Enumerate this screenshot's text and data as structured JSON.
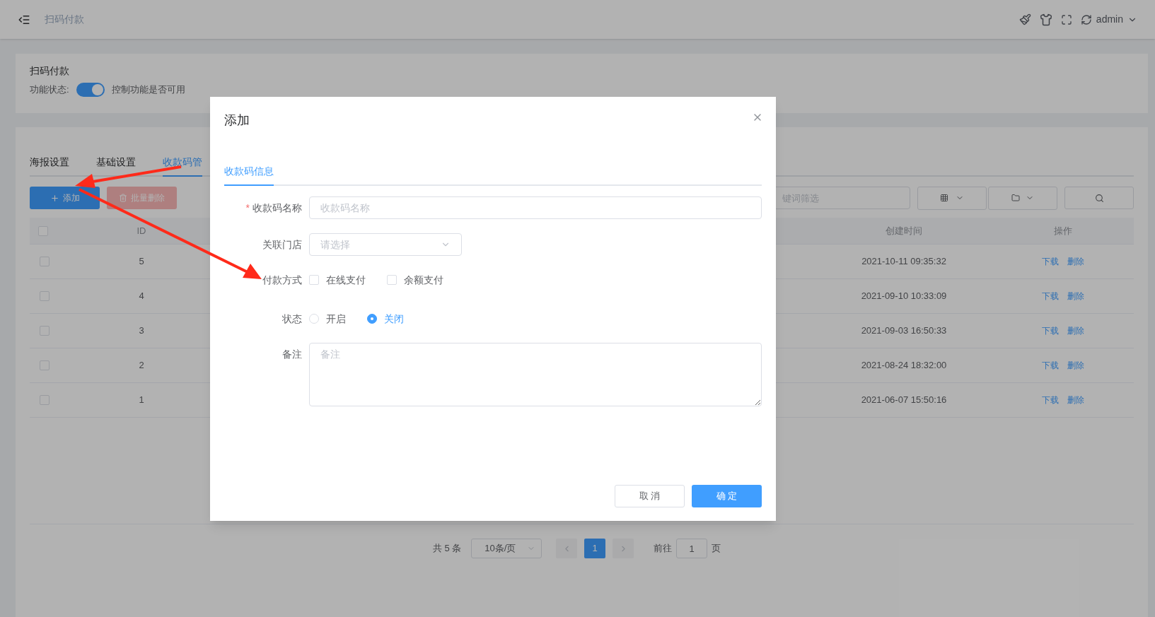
{
  "header": {
    "title": "扫码付款",
    "user": "admin"
  },
  "feature_card": {
    "title": "扫码付款",
    "status_label": "功能状态:",
    "switch_on": true,
    "hint": "控制功能是否可用"
  },
  "tabs": [
    {
      "label": "海报设置",
      "selected": false
    },
    {
      "label": "基础设置",
      "selected": false
    },
    {
      "label": "收款码管",
      "selected": true
    }
  ],
  "toolbar": {
    "add_button": "添加",
    "batch_delete_button": "批量删除",
    "batch_delete_disabled": true,
    "search_placeholder": "键词筛选"
  },
  "table": {
    "columns": [
      "ID",
      "创建时间",
      "操作"
    ],
    "header_checked": false,
    "rows": [
      {
        "id": "5",
        "created": "2021-10-11 09:35:32",
        "actions": [
          "下载",
          "删除"
        ],
        "checked": false
      },
      {
        "id": "4",
        "created": "2021-09-10 10:33:09",
        "actions": [
          "下载",
          "删除"
        ],
        "checked": false
      },
      {
        "id": "3",
        "created": "2021-09-03 16:50:33",
        "actions": [
          "下载",
          "删除"
        ],
        "checked": false
      },
      {
        "id": "2",
        "created": "2021-08-24 18:32:00",
        "actions": [
          "下载",
          "删除"
        ],
        "checked": false
      },
      {
        "id": "1",
        "created": "2021-06-07 15:50:16",
        "actions": [
          "下载",
          "删除"
        ],
        "checked": false
      }
    ]
  },
  "pagination": {
    "total": "共 5 条",
    "page_size": "10条/页",
    "pages": [
      {
        "label": "1",
        "selected": true
      }
    ],
    "goto_label": "前往",
    "goto_value": "1",
    "page_suffix": "页"
  },
  "dialog": {
    "title": "添加",
    "tabs": [
      {
        "label": "收款码信息",
        "selected": true
      }
    ],
    "fields": [
      {
        "kind": "text",
        "label": "收款码名称",
        "required_mark": "*",
        "placeholder": "收款码名称"
      },
      {
        "kind": "select",
        "label": "关联门店",
        "placeholder": "请选择"
      },
      {
        "kind": "checkbox",
        "label": "付款方式",
        "options": [
          {
            "label": "在线支付",
            "checked": false
          },
          {
            "label": "余额支付",
            "checked": false
          }
        ]
      },
      {
        "kind": "radio",
        "label": "状态",
        "options": [
          {
            "label": "开启",
            "selected": false
          },
          {
            "label": "关闭",
            "selected": true
          }
        ]
      },
      {
        "kind": "textarea",
        "label": "备注",
        "placeholder": "备注"
      }
    ],
    "cancel_button": "取 消",
    "confirm_button": "确 定"
  }
}
